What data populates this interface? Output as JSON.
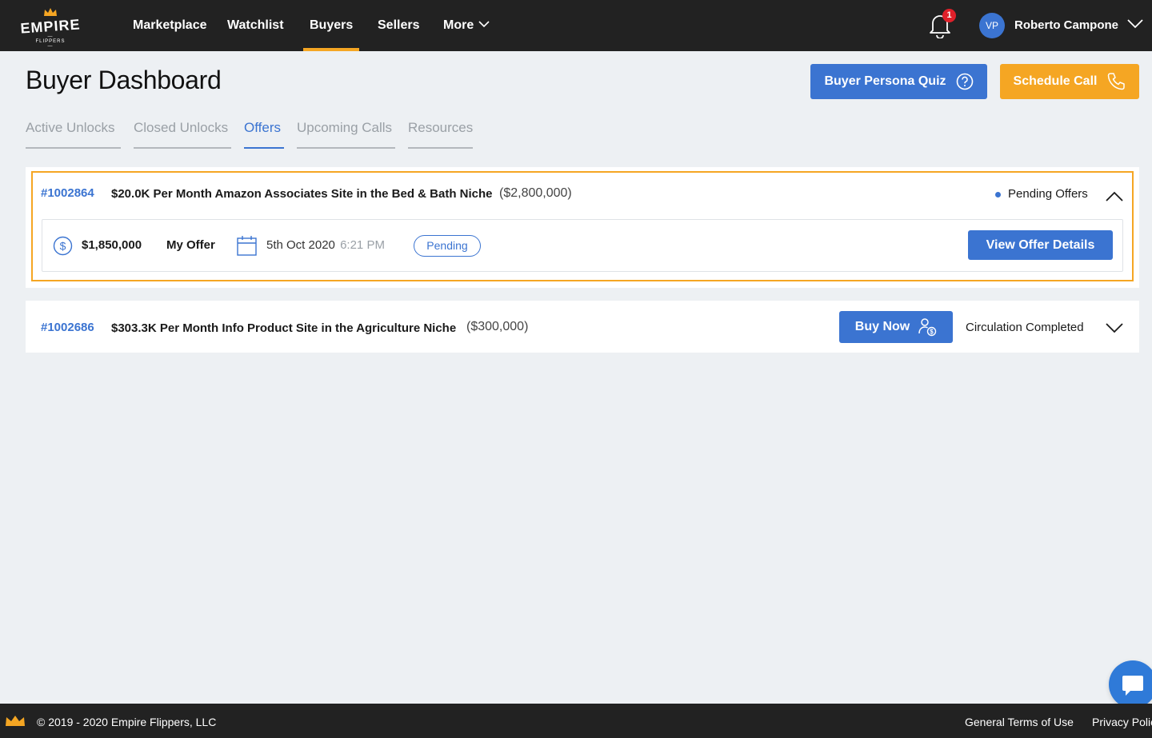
{
  "nav": {
    "logo_text": "EMPIRE",
    "logo_sub": "— FLIPPERS —",
    "items": [
      {
        "label": "Marketplace"
      },
      {
        "label": "Watchlist"
      },
      {
        "label": "Buyers"
      },
      {
        "label": "Sellers"
      },
      {
        "label": "More"
      }
    ],
    "active": "Buyers",
    "notification_count": "1",
    "user_initials": "VP",
    "user_name": "Roberto Campone"
  },
  "header": {
    "title": "Buyer Dashboard",
    "quiz_button": "Buyer Persona Quiz",
    "schedule_button": "Schedule Call"
  },
  "tabs": [
    {
      "label": "Active Unlocks"
    },
    {
      "label": "Closed Unlocks"
    },
    {
      "label": "Offers"
    },
    {
      "label": "Upcoming Calls"
    },
    {
      "label": "Resources"
    }
  ],
  "active_tab": "Offers",
  "listings": [
    {
      "id": "#1002864",
      "title": "$20.0K Per Month Amazon Associates Site in the Bed & Bath Niche",
      "price": "($2,800,000)",
      "status": "Pending Offers",
      "offer": {
        "amount": "$1,850,000",
        "label": "My Offer",
        "date": "5th Oct 2020",
        "time": "6:21 PM",
        "state": "Pending",
        "button": "View Offer Details"
      }
    },
    {
      "id": "#1002686",
      "title": "$303.3K Per Month Info Product Site in the Agriculture Niche",
      "price": "($300,000)",
      "status": "Circulation Completed",
      "button": "Buy Now"
    }
  ],
  "footer": {
    "copyright": "© 2019 - 2020 Empire Flippers, LLC",
    "links": [
      {
        "label": "General Terms of Use"
      },
      {
        "label": "Privacy Polic"
      }
    ]
  },
  "colors": {
    "brand_orange": "#f5a623",
    "brand_blue": "#3b74d1",
    "nav_bg": "#222222",
    "page_bg": "#edf0f3"
  }
}
